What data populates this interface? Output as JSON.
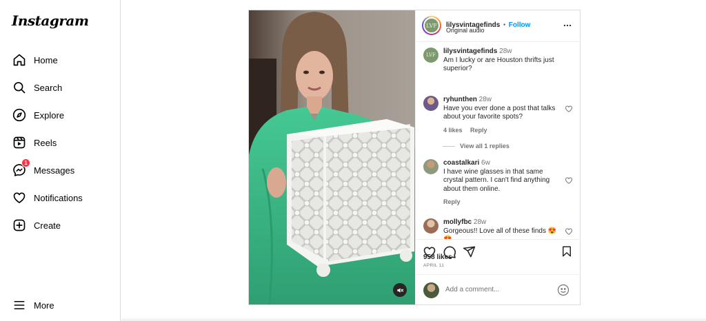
{
  "app": {
    "logo": "Instagram"
  },
  "nav": {
    "home": "Home",
    "search": "Search",
    "explore": "Explore",
    "reels": "Reels",
    "messages": "Messages",
    "messages_badge": "1",
    "notifications": "Notifications",
    "create": "Create",
    "more": "More"
  },
  "post": {
    "author": "lilysvintagefinds",
    "separator": "•",
    "follow_label": "Follow",
    "audio": "Original audio",
    "avatar_initials": "LVF",
    "caption": {
      "user": "lilysvintagefinds",
      "time": "28w",
      "text": "Am I lucky or are Houston thrifts just superior?"
    },
    "comments": [
      {
        "user": "ryhunthen",
        "time": "28w",
        "text": "Have you ever done a post that talks about your favorite spots?",
        "likes": "4 likes",
        "reply": "Reply",
        "view_replies": "View all 1 replies"
      },
      {
        "user": "coastalkari",
        "time": "6w",
        "text": "I have wine glasses in that same crystal pattern. I can't find anything about them online.",
        "reply": "Reply"
      },
      {
        "user": "mollyfbc",
        "time": "28w",
        "text": "Gorgeous!! Love all of these finds 😍😍"
      }
    ],
    "likes_count": "958 likes",
    "date": "APRIL 11",
    "comment_placeholder": "Add a comment..."
  },
  "colors": {
    "accent": "#0095f6",
    "badge": "#ff3040",
    "shirt": "#3dbd8a"
  }
}
